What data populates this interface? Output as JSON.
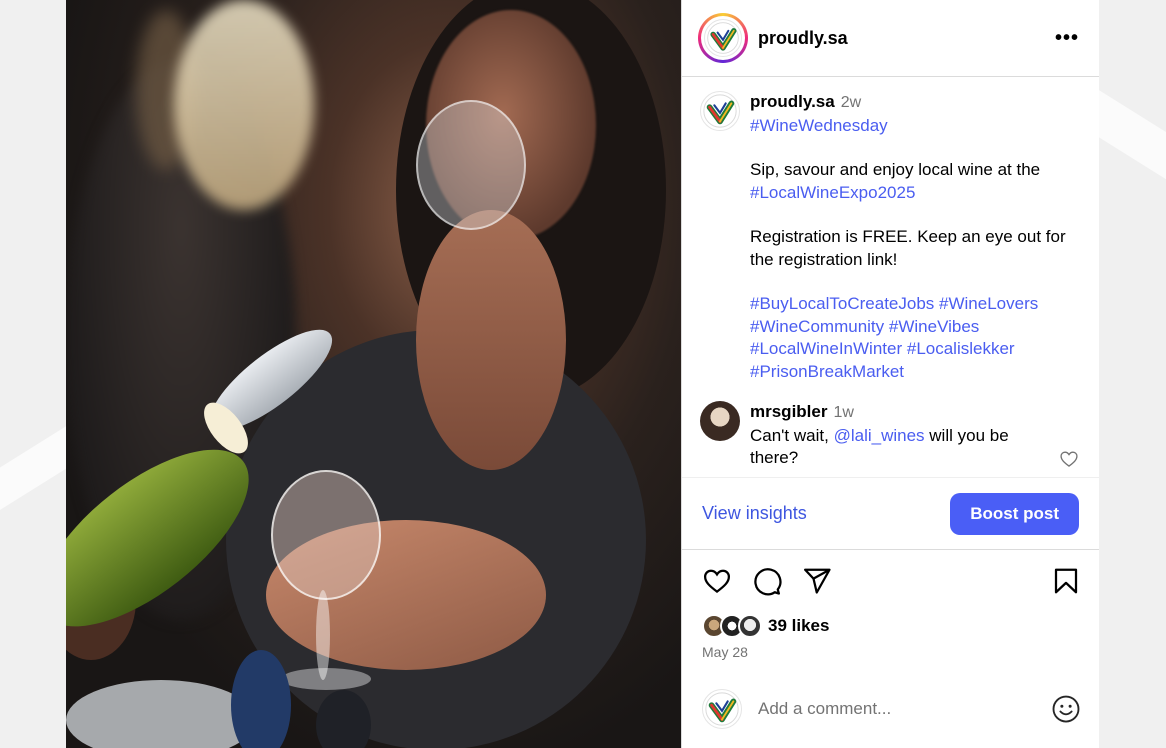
{
  "account": {
    "username": "proudly.sa"
  },
  "header": {
    "more_icon": "more-horizontal-icon",
    "more_label": "•••"
  },
  "caption": {
    "username": "proudly.sa",
    "time": "2w",
    "line1_tag": "#WineWednesday",
    "para1": "Sip, savour and enjoy local wine at the",
    "para1_tag": "#LocalWineExpo2025",
    "para2": "Registration is FREE. Keep an eye out for the registration link!",
    "tags": [
      "#BuyLocalToCreateJobs",
      "#WineLovers",
      "#WineCommunity",
      "#WineVibes",
      "#LocalWineInWinter",
      "#Localislekker",
      "#PrisonBreakMarket"
    ]
  },
  "comment": {
    "username": "mrsgibler",
    "time": "1w",
    "text_before": "Can't wait,",
    "mention": "@lali_wines",
    "text_after": "will you be there?"
  },
  "actions": {
    "insights": "View insights",
    "boost": "Boost post"
  },
  "engagement": {
    "likes": "39 likes",
    "date": "May 28"
  },
  "add_comment": {
    "placeholder": "Add a comment..."
  },
  "colors": {
    "link": "#4a5df0",
    "boost_bg": "#4a5ef6",
    "insights": "#3e56e0"
  },
  "icons": [
    "heart-icon",
    "comment-icon",
    "share-icon",
    "bookmark-icon",
    "emoji-icon",
    "more-horizontal-icon"
  ]
}
